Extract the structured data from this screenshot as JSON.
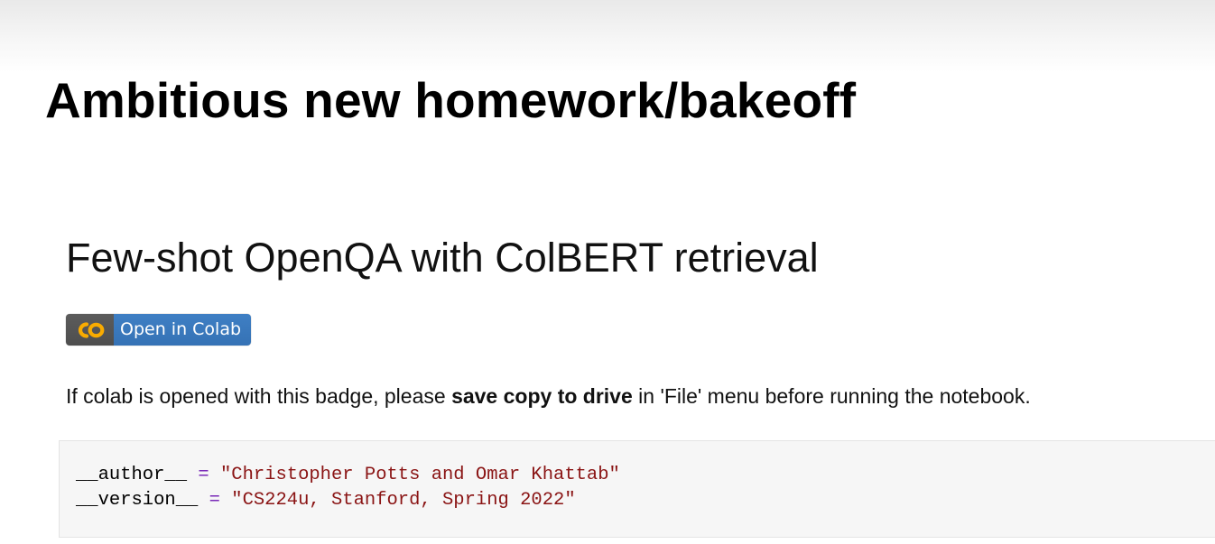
{
  "slide": {
    "title": "Ambitious new homework/bakeoff"
  },
  "notebook": {
    "heading": "Few-shot OpenQA with ColBERT retrieval",
    "badge": {
      "logo_text": "CO",
      "label": "Open in Colab",
      "logo_color": "#f9ab00",
      "label_bg": "#3a7abf"
    },
    "instructions": {
      "before": "If colab is opened with this badge, please ",
      "emphasis": "save copy to drive",
      "after": " in 'File' menu before running the notebook."
    },
    "code": [
      {
        "name": "__author__",
        "op": "=",
        "value": "\"Christopher Potts and Omar Khattab\""
      },
      {
        "name": "__version__",
        "op": "=",
        "value": "\"CS224u, Stanford, Spring 2022\""
      }
    ]
  }
}
